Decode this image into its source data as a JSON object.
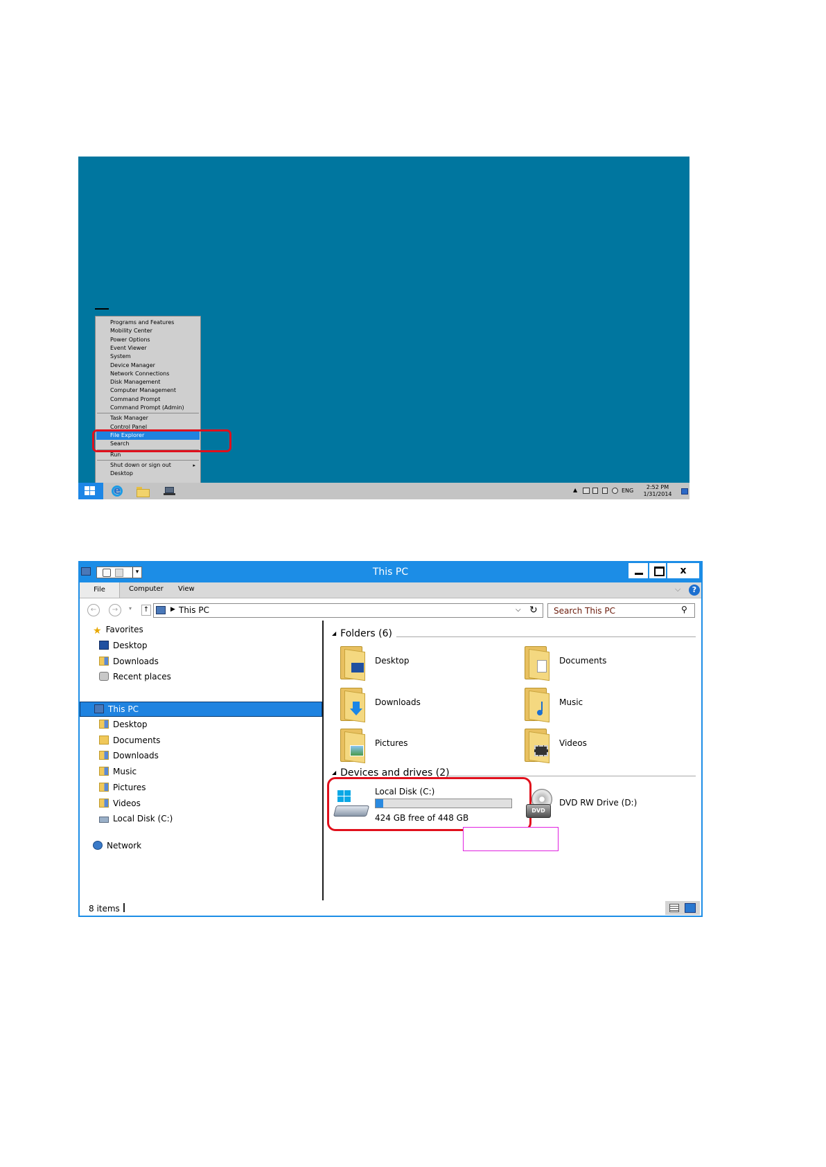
{
  "desktop": {
    "menu_items": [
      {
        "label": "Programs and Features"
      },
      {
        "label": "Mobility Center"
      },
      {
        "label": "Power Options"
      },
      {
        "label": "Event Viewer"
      },
      {
        "label": "System"
      },
      {
        "label": "Device Manager"
      },
      {
        "label": "Network Connections"
      },
      {
        "label": "Disk Management"
      },
      {
        "label": "Computer Management"
      },
      {
        "label": "Command Prompt"
      },
      {
        "label": "Command Prompt (Admin)"
      },
      {
        "label": "Task Manager"
      },
      {
        "label": "Control Panel"
      },
      {
        "label": "File Explorer",
        "selected": true
      },
      {
        "label": "Search"
      },
      {
        "label": "Run"
      },
      {
        "label": "Shut down or sign out",
        "submenu": true
      },
      {
        "label": "Desktop"
      }
    ],
    "submenu_arrow": "▸",
    "taskbar": {
      "tray_caret": "▲",
      "language": "ENG",
      "time": "2:52 PM",
      "date": "1/31/2014"
    },
    "colors": {
      "desktop_bg": "#00769f",
      "accent": "#1c86e6",
      "highlight": "#e0101c"
    }
  },
  "explorer": {
    "title": "This PC",
    "close_glyph": "x",
    "ribbon": {
      "file": "File",
      "computer": "Computer",
      "view": "View",
      "expand_glyph": "⌵",
      "help_glyph": "?"
    },
    "nav": {
      "back_glyph": "←",
      "forward_glyph": "→",
      "recent_glyph": "▾",
      "up_glyph": "↑"
    },
    "address": {
      "separator": "▶",
      "path": "This PC",
      "dropdown_glyph": "⌵",
      "refresh_glyph": "↻"
    },
    "search": {
      "placeholder": "Search This PC",
      "icon_glyph": "⚲"
    },
    "nav_pane": {
      "favorites": {
        "label": "Favorites",
        "items": [
          {
            "label": "Desktop"
          },
          {
            "label": "Downloads"
          },
          {
            "label": "Recent places"
          }
        ]
      },
      "this_pc": {
        "label": "This PC",
        "items": [
          {
            "label": "Desktop"
          },
          {
            "label": "Documents"
          },
          {
            "label": "Downloads"
          },
          {
            "label": "Music"
          },
          {
            "label": "Pictures"
          },
          {
            "label": "Videos"
          },
          {
            "label": "Local Disk (C:)"
          }
        ]
      },
      "network": {
        "label": "Network"
      }
    },
    "folders_group": {
      "label": "Folders (6)",
      "collapse_glyph": "◢",
      "items": [
        {
          "label": "Desktop"
        },
        {
          "label": "Documents"
        },
        {
          "label": "Downloads"
        },
        {
          "label": "Music"
        },
        {
          "label": "Pictures"
        },
        {
          "label": "Videos"
        }
      ]
    },
    "devices_group": {
      "label": "Devices and drives (2)",
      "collapse_glyph": "◢",
      "drive_c": {
        "name": "Local Disk (C:)",
        "free_text": "424 GB free of 448 GB",
        "used_fraction": 0.0536
      },
      "drive_d": {
        "name": "DVD RW Drive (D:)",
        "badge": "DVD"
      }
    },
    "status": {
      "item_count": "8 items"
    }
  }
}
